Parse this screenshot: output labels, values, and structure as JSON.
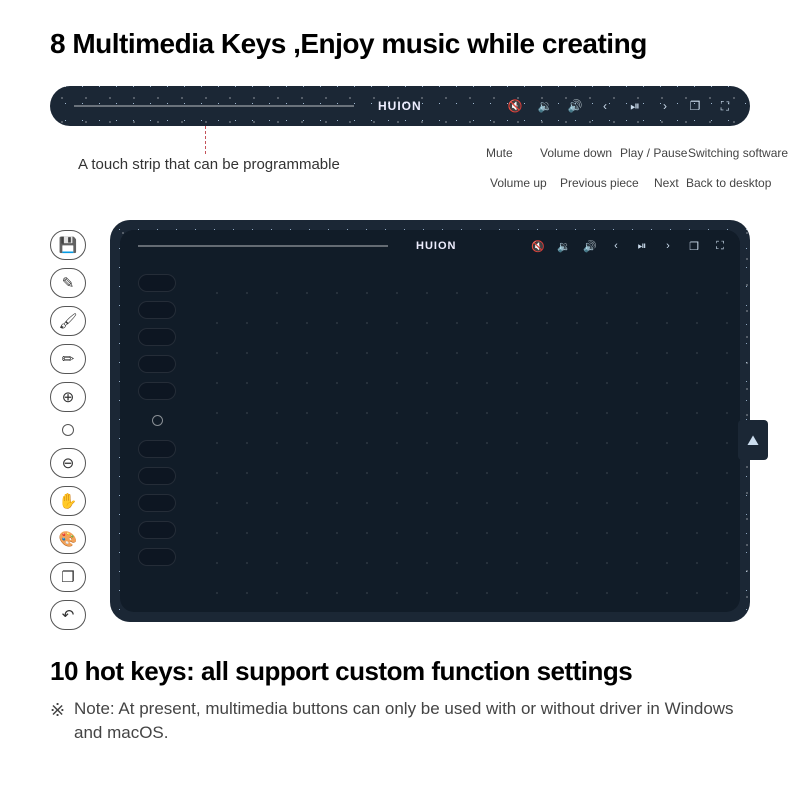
{
  "headline": "8 Multimedia Keys ,Enjoy music while creating",
  "brand": "HUION",
  "touch_strip_label": "A touch strip that can be programmable",
  "media_labels": {
    "row_up": [
      "Mute",
      "Volume down",
      "Play / Pause",
      "Switching software"
    ],
    "row_dn": [
      "Volume up",
      "Previous piece",
      "Next",
      "Back to desktop"
    ]
  },
  "media_glyphs": [
    "🔇",
    "🔉",
    "🔊",
    "‹",
    "⏯",
    "›",
    "❐",
    "⛶"
  ],
  "side_icons": [
    "💾",
    "✎",
    "🖌",
    "✏",
    "⊕",
    "○",
    "⊖",
    "✋",
    "🎨",
    "❐",
    "↶"
  ],
  "bottom_heading": "10 hot keys: all support custom function settings",
  "note_mark": "※",
  "note_text": "Note: At present, multimedia buttons can only be used with or without driver in Windows and macOS."
}
